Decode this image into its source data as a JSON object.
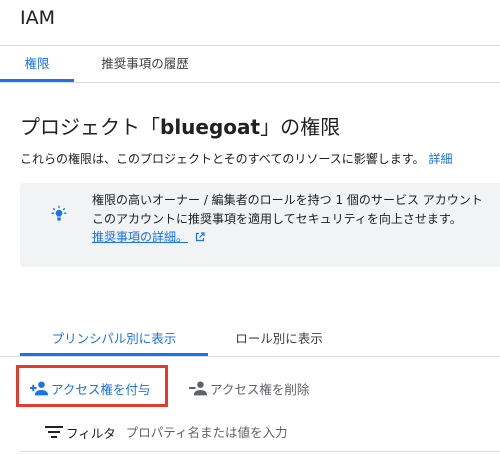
{
  "app": {
    "title": "IAM"
  },
  "top_tabs": [
    {
      "label": "権限",
      "active": true
    },
    {
      "label": "推奨事項の履歴",
      "active": false
    }
  ],
  "page": {
    "title_prefix": "プロジェクト「",
    "project_name": "bluegoat",
    "title_suffix": "」の権限",
    "description": "これらの権限は、このプロジェクトとそのすべてのリソースに影響します。",
    "description_link": "詳細"
  },
  "recommendation": {
    "icon": "lightbulb-icon",
    "line1": "権限の高いオーナー / 編集者のロールを持つ 1 個のサービス アカウント",
    "line2": "このアカウントに推奨事項を適用してセキュリティを向上させます。",
    "link": "推奨事項の詳細。",
    "link_icon": "open-in-new-icon"
  },
  "view_tabs": [
    {
      "label": "プリンシパル別に表示",
      "active": true
    },
    {
      "label": "ロール別に表示",
      "active": false
    }
  ],
  "actions": {
    "grant_label": "アクセス権を付与",
    "grant_icon": "person-add-icon",
    "remove_label": "アクセス権を削除",
    "remove_icon": "person-remove-icon"
  },
  "filter": {
    "icon": "filter-list-icon",
    "label": "フィルタ",
    "placeholder": "プロパティ名または値を入力",
    "value": ""
  },
  "colors": {
    "accent": "#1a73e8",
    "highlight_border": "#e53a2e",
    "card_bg": "#f1f3f4"
  }
}
